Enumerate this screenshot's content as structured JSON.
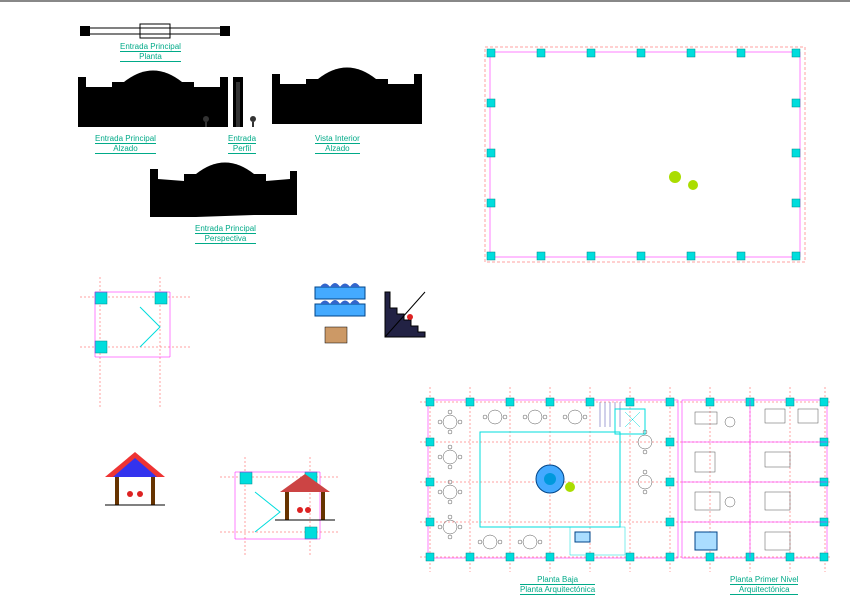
{
  "labels": {
    "entrada_planta_1": "Entrada Principal",
    "entrada_planta_2": "Planta",
    "entrada_alzado_1": "Entrada Principal",
    "entrada_alzado_2": "Alzado",
    "entrada_perfil_1": "Entrada",
    "entrada_perfil_2": "Perfil",
    "vista_interior_1": "Vista Interior",
    "vista_interior_2": "Alzado",
    "perspectiva_1": "Entrada Principal",
    "perspectiva_2": "Perspectiva",
    "planta_baja_1": "Planta Baja",
    "planta_baja_2": "Planta Arquitectónica",
    "primer_nivel_1": "Planta Primer Nivel",
    "primer_nivel_2": "Arquitectónica"
  },
  "colors": {
    "label": "#0a8",
    "column": "#0dd",
    "grid": "#f44",
    "plan": "#f0f",
    "accent_dot": "#ad0"
  }
}
